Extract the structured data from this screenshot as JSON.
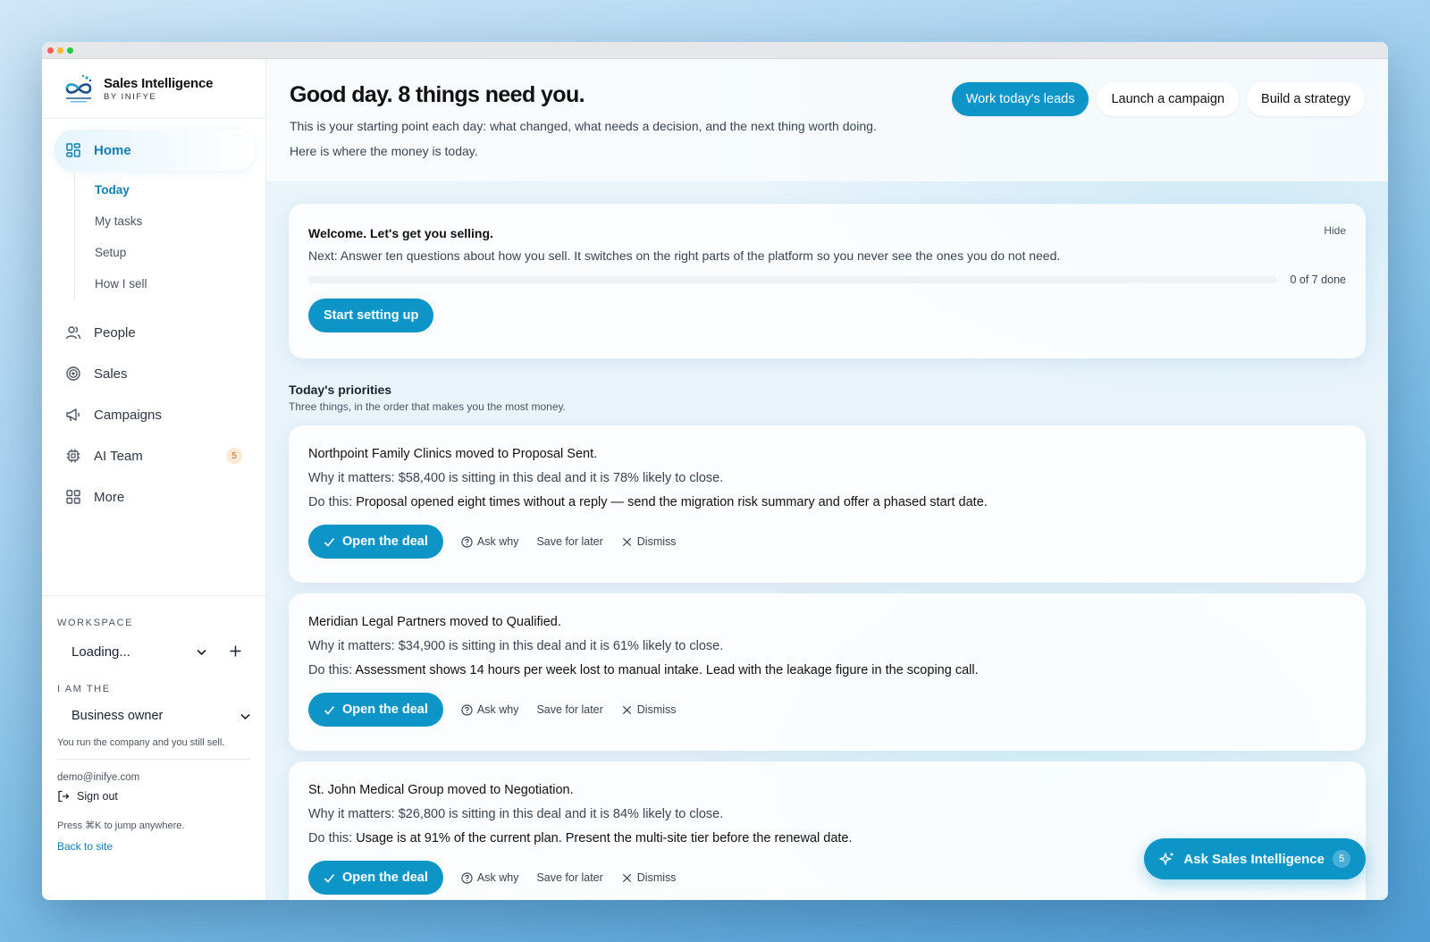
{
  "brand": {
    "name": "Sales Intelligence",
    "sub": "BY INIFYE"
  },
  "nav": {
    "home": "Home",
    "subitems": [
      "Today",
      "My tasks",
      "Setup",
      "How I sell"
    ],
    "items": [
      {
        "label": "People"
      },
      {
        "label": "Sales"
      },
      {
        "label": "Campaigns"
      },
      {
        "label": "AI Team",
        "badge": "5"
      },
      {
        "label": "More"
      }
    ]
  },
  "sidebar_bottom": {
    "workspace_label": "WORKSPACE",
    "workspace_value": "Loading...",
    "role_label": "I AM THE",
    "role_value": "Business owner",
    "role_desc": "You run the company and you still sell.",
    "email": "demo@inifye.com",
    "sign_out": "Sign out",
    "hint": "Press ⌘K to jump anywhere.",
    "back": "Back to site"
  },
  "header": {
    "title": "Good day. 8 things need you.",
    "line1": "This is your starting point each day: what changed, what needs a decision, and the next thing worth doing.",
    "line2": "Here is where the money is today.",
    "actions": [
      "Work today's leads",
      "Launch a campaign",
      "Build a strategy"
    ]
  },
  "welcome": {
    "title": "Welcome. Let's get you selling.",
    "desc": "Next: Answer ten questions about how you sell. It switches on the right parts of the platform so you never see the ones you do not need.",
    "hide": "Hide",
    "progress": 0,
    "done": "0 of 7 done",
    "cta": "Start setting up"
  },
  "priorities": {
    "title": "Today's priorities",
    "subtitle": "Three things, in the order that makes you the most money.",
    "items": [
      {
        "title": "Northpoint Family Clinics moved to Proposal Sent.",
        "why_label": "Why it matters:",
        "why": "$58,400 is sitting in this deal and it is 78% likely to close.",
        "do_label": "Do this:",
        "do": "Proposal opened eight times without a reply — send the migration risk summary and offer a phased start date."
      },
      {
        "title": "Meridian Legal Partners moved to Qualified.",
        "why_label": "Why it matters:",
        "why": "$34,900 is sitting in this deal and it is 61% likely to close.",
        "do_label": "Do this:",
        "do": "Assessment shows 14 hours per week lost to manual intake. Lead with the leakage figure in the scoping call."
      },
      {
        "title": "St. John Medical Group moved to Negotiation.",
        "why_label": "Why it matters:",
        "why": "$26,800 is sitting in this deal and it is 84% likely to close.",
        "do_label": "Do this:",
        "do": "Usage is at 91% of the current plan. Present the multi-site tier before the renewal date."
      }
    ],
    "actions": {
      "open": "Open the deal",
      "ask": "Ask why",
      "save": "Save for later",
      "dismiss": "Dismiss"
    }
  },
  "assistant": {
    "label": "Ask Sales Intelligence",
    "count": "5"
  },
  "colors": {
    "accent": "#0e95c8",
    "badge_bg": "#fde9d6",
    "badge_text": "#c86a1a"
  }
}
